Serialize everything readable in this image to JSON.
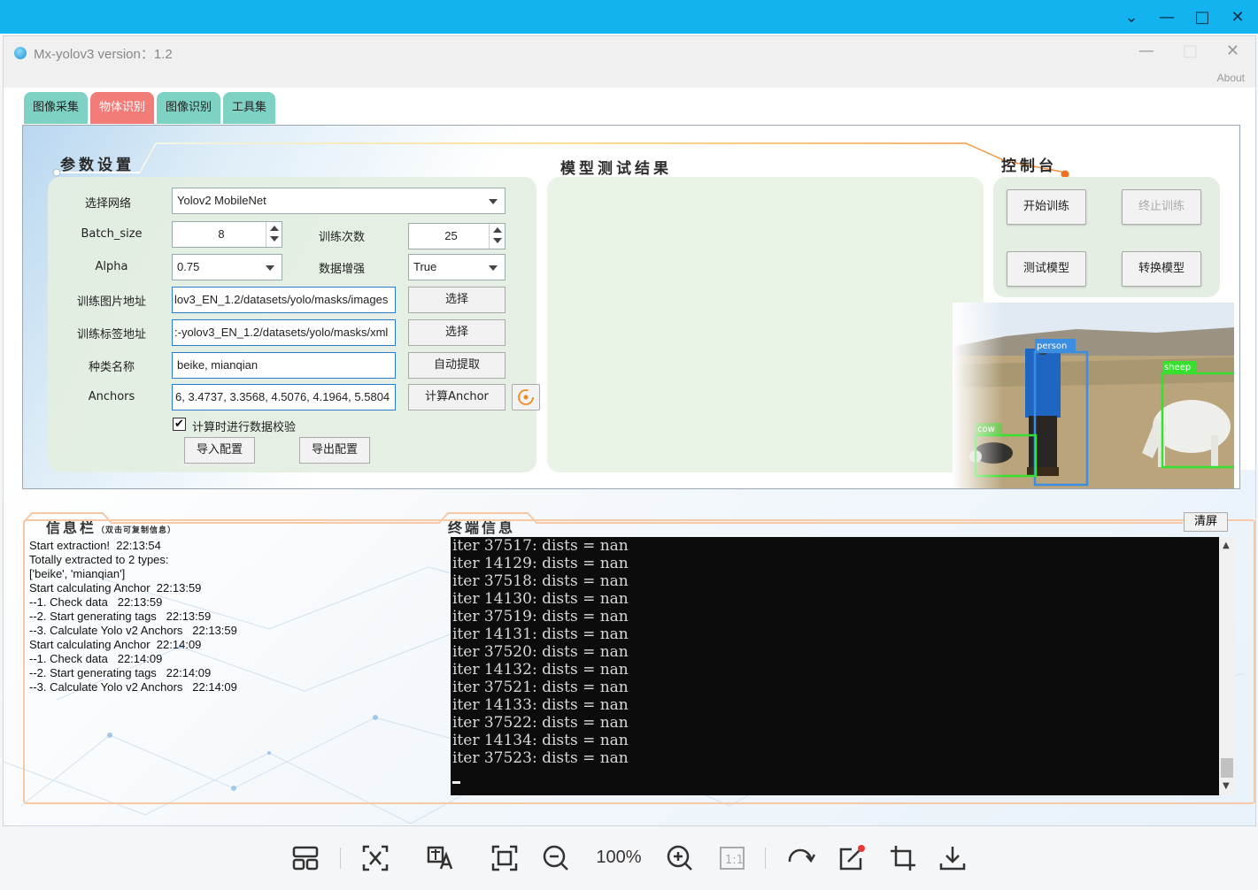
{
  "window": {
    "title": "Mx-yolov3 version：1.2",
    "about": "About"
  },
  "tabs": [
    {
      "label": "图像采集",
      "active": false
    },
    {
      "label": "物体识别",
      "active": true
    },
    {
      "label": "图像识别",
      "active": false
    },
    {
      "label": "工具集",
      "active": false
    }
  ],
  "sections": {
    "params": "参数设置",
    "results": "模型测试结果",
    "console": "控制台",
    "info": "信息栏",
    "info_sub": "（双击可复制信息）",
    "terminal": "终端信息"
  },
  "params": {
    "network_label": "选择网络",
    "network_value": "Yolov2 MobileNet",
    "batch_label": "Batch_size",
    "batch_value": "8",
    "epochs_label": "训练次数",
    "epochs_value": "25",
    "alpha_label": "Alpha",
    "alpha_value": "0.75",
    "augment_label": "数据增强",
    "augment_value": "True",
    "img_path_label": "训练图片地址",
    "img_path_value": "lov3_EN_1.2/datasets/yolo/masks/images",
    "xml_path_label": "训练标签地址",
    "xml_path_value": ":-yolov3_EN_1.2/datasets/yolo/masks/xml",
    "classes_label": "种类名称",
    "classes_value": "beike, mianqian",
    "anchors_label": "Anchors",
    "anchors_value": "6, 3.4737, 3.3568, 4.5076, 4.1964, 5.5804",
    "select_btn": "选择",
    "select_btn2": "选择",
    "auto_extract_btn": "自动提取",
    "calc_anchor_btn": "计算Anchor",
    "verify_label": "计算时进行数据校验",
    "verify_checked": true,
    "import_btn": "导入配置",
    "export_btn": "导出配置"
  },
  "console": {
    "start_train": "开始训练",
    "stop_train": "终止训练",
    "test_model": "测试模型",
    "convert_model": "转换模型"
  },
  "detections": [
    {
      "label": "person",
      "color": "#3b8ee0"
    },
    {
      "label": "sheep",
      "color": "#37e02f"
    },
    {
      "label": "cow",
      "color": "#37e02f"
    }
  ],
  "info_lines": [
    "Start extraction!  22:13:54",
    "Totally extracted to 2 types:",
    "['beike', 'mianqian']",
    "Start calculating Anchor  22:13:59",
    "--1. Check data   22:13:59",
    "--2. Start generating tags   22:13:59",
    "--3. Calculate Yolo v2 Anchors   22:13:59",
    "Start calculating Anchor  22:14:09",
    "--1. Check data   22:14:09",
    "--2. Start generating tags   22:14:09",
    "--3. Calculate Yolo v2 Anchors   22:14:09"
  ],
  "terminal_lines": [
    "iter 37517: dists = nan",
    "iter 14129: dists = nan",
    "iter 37518: dists = nan",
    "iter 14130: dists = nan",
    "iter 37519: dists = nan",
    "iter 14131: dists = nan",
    "iter 37520: dists = nan",
    "iter 14132: dists = nan",
    "iter 37521: dists = nan",
    "iter 14133: dists = nan",
    "iter 37522: dists = nan",
    "iter 14134: dists = nan",
    "iter 37523: dists = nan"
  ],
  "clear_btn": "清屏",
  "viewer": {
    "zoom": "100%"
  }
}
